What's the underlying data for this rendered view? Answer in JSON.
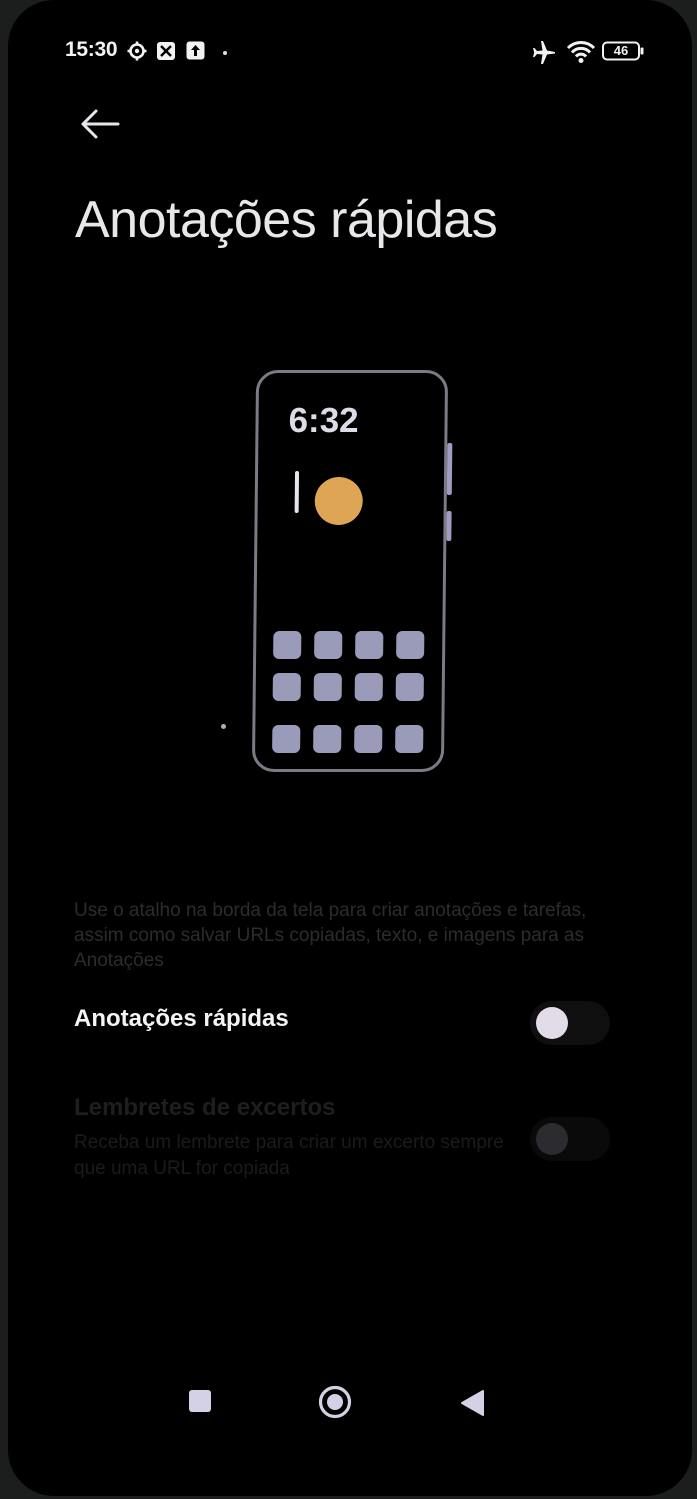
{
  "status_bar": {
    "time": "15:30",
    "battery": "46"
  },
  "header": {
    "title": "Anotações rápidas"
  },
  "illustration": {
    "clock": "6:32"
  },
  "description": "Use o atalho na borda da tela para criar anotações e tarefas, assim como salvar URLs copiadas, texto, e imagens para as Anotações",
  "settings": [
    {
      "title": "Anotações rápidas",
      "toggle_on": false,
      "enabled": true
    },
    {
      "title": "Lembretes de excertos",
      "subtitle": "Receba um lembrete para criar um excerto sempre que uma URL for copiada",
      "toggle_on": false,
      "enabled": false
    }
  ],
  "colors": {
    "background": "#000000",
    "accent_sun": "#dda554",
    "app_icon": "#9a9bb9",
    "text_primary": "#f4f4f6",
    "text_disabled": "#1e1e20"
  },
  "icons": {
    "status": [
      "settings-gear-icon",
      "app-notification-icon",
      "upload-icon",
      "airplane-mode-icon",
      "wifi-icon",
      "battery-icon"
    ],
    "nav": [
      "recents-square-icon",
      "home-circle-icon",
      "back-triangle-icon"
    ]
  }
}
